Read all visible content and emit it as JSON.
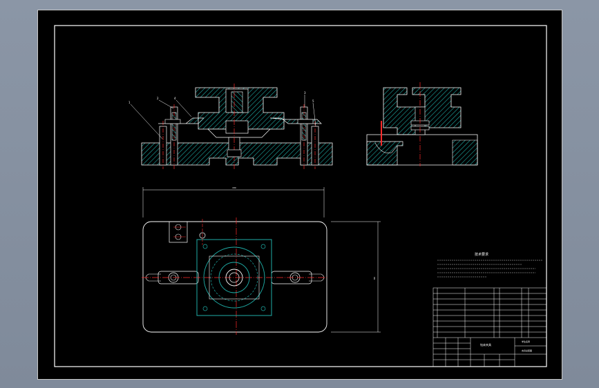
{
  "colors": {
    "background": "#000000",
    "outline": "#ffffff",
    "hatch": "#1faea8",
    "centerline": "#ff2a2a",
    "frame": "#ffffff",
    "window_bg": "#8b96a6"
  },
  "balloons": [
    "1",
    "2",
    "4",
    "3",
    "5"
  ],
  "dimensions": {
    "width_label": "180",
    "height_label": "80"
  },
  "notes": {
    "title": "技术要求"
  },
  "title_block": {
    "title": "钻床夹具",
    "unit": "学生名称",
    "drawing_no": "夹具总装图"
  }
}
